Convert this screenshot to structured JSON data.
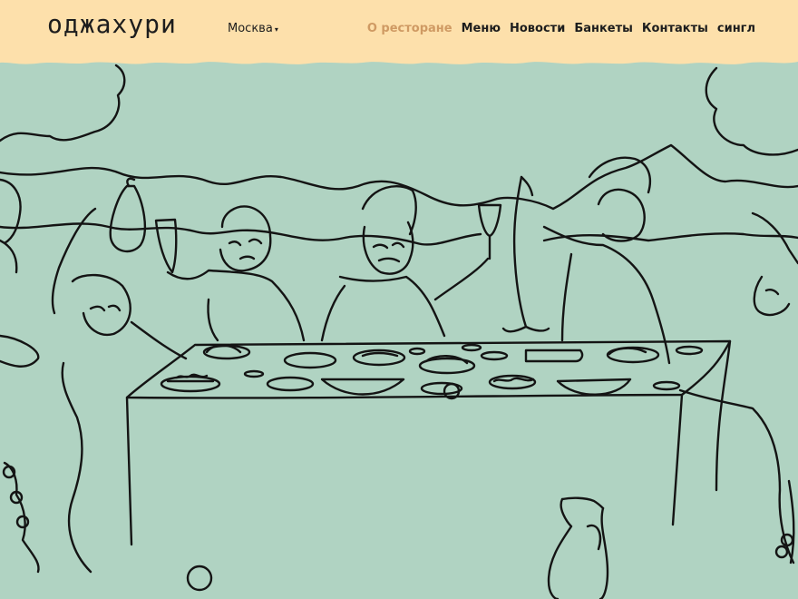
{
  "header": {
    "logo": "оджахури",
    "city": "Москва",
    "nav": [
      {
        "label": "О ресторане",
        "active": true
      },
      {
        "label": "Меню",
        "active": false
      },
      {
        "label": "Новости",
        "active": false
      },
      {
        "label": "Банкеты",
        "active": false
      },
      {
        "label": "Контакты",
        "active": false
      },
      {
        "label": "сингл",
        "active": false
      }
    ]
  },
  "colors": {
    "header_bg": "#fde0ab",
    "page_bg": "#b0d3c2",
    "accent": "#cf9a63",
    "ink": "#1d1d1d"
  },
  "illustration": {
    "subject": "feast-scene-line-drawing"
  }
}
